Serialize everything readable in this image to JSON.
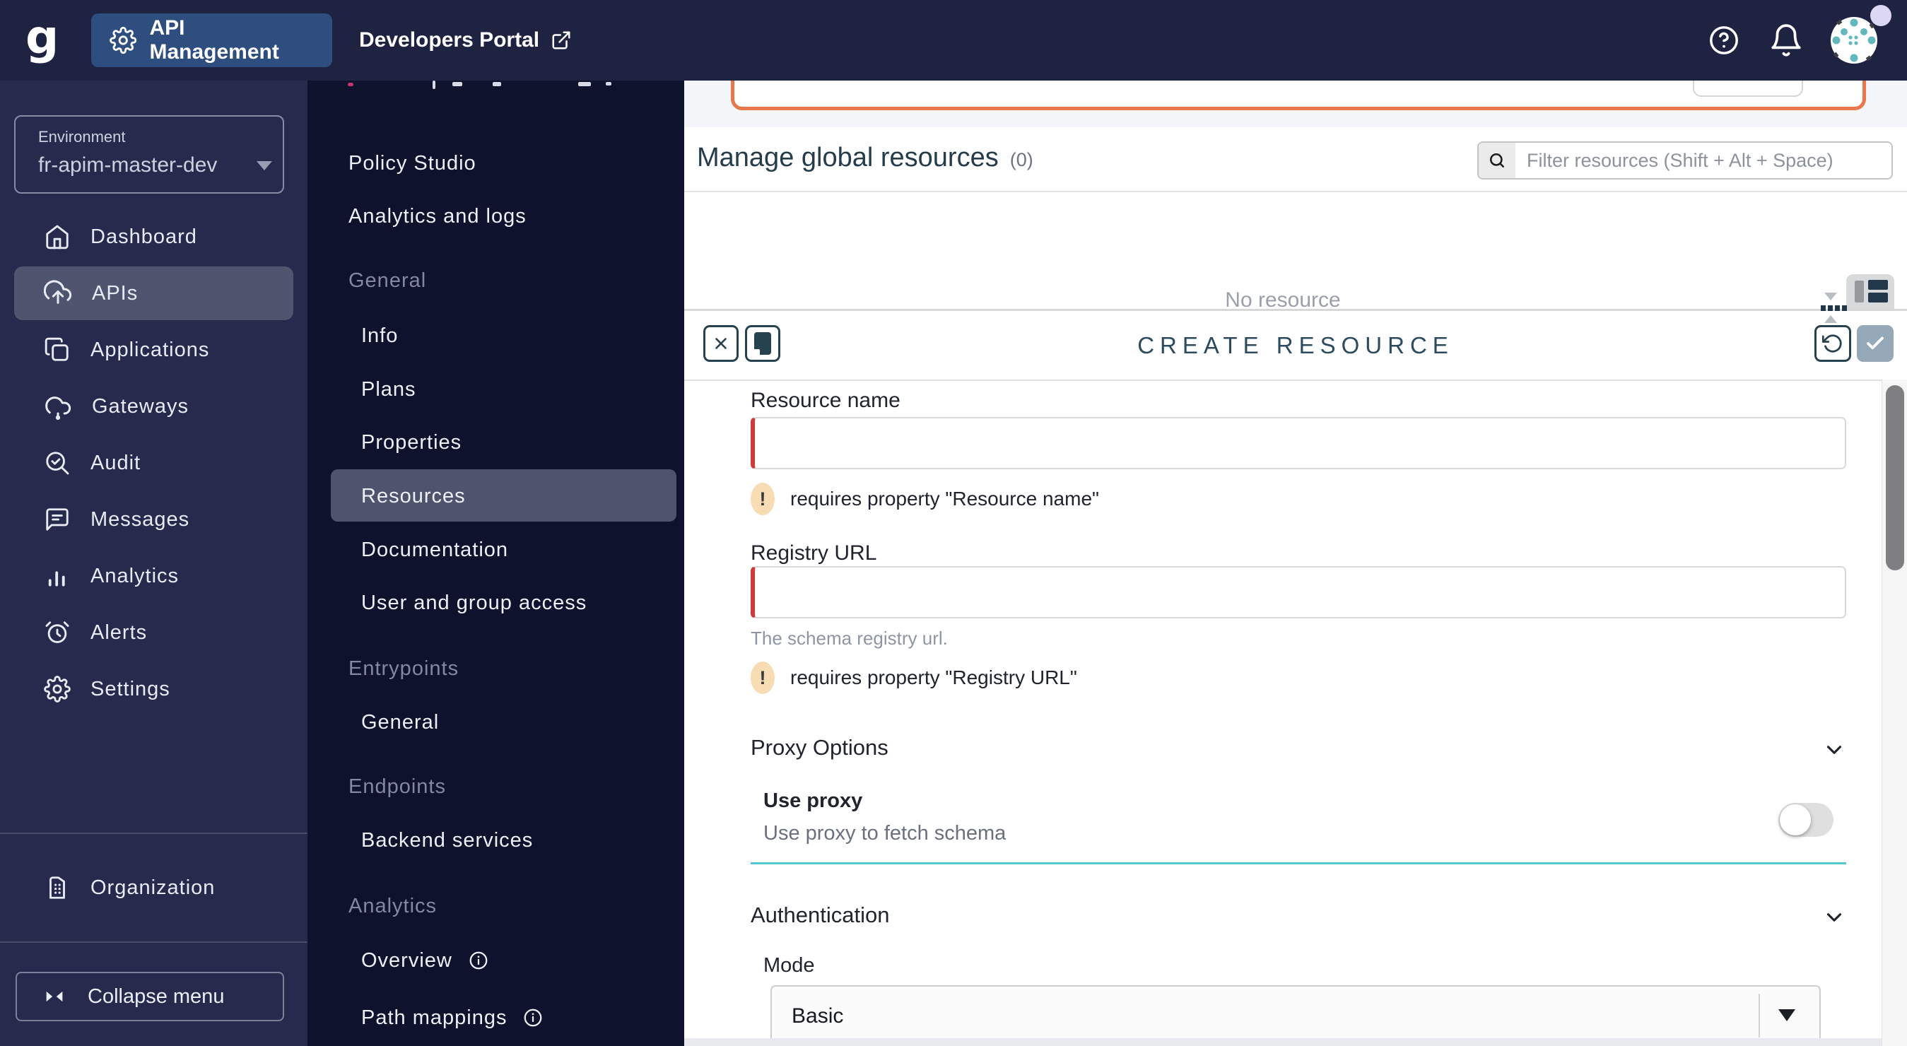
{
  "header": {
    "logo_letter": "g",
    "app_name": "API Management",
    "portal_name": "Developers Portal"
  },
  "sidebar": {
    "environment_label": "Environment",
    "environment_value": "fr-apim-master-dev",
    "items": [
      {
        "label": "Dashboard",
        "icon": "home"
      },
      {
        "label": "APIs",
        "icon": "cloud-upload",
        "selected": true
      },
      {
        "label": "Applications",
        "icon": "applications"
      },
      {
        "label": "Gateways",
        "icon": "cloud"
      },
      {
        "label": "Audit",
        "icon": "search-check"
      },
      {
        "label": "Messages",
        "icon": "chat"
      },
      {
        "label": "Analytics",
        "icon": "bar-chart"
      },
      {
        "label": "Alerts",
        "icon": "alarm"
      },
      {
        "label": "Settings",
        "icon": "gear"
      }
    ],
    "organization_label": "Organization",
    "collapse_label": "Collapse menu"
  },
  "api_menu": {
    "items": [
      {
        "label": "Policy Studio",
        "type": "item"
      },
      {
        "label": "Analytics and logs",
        "type": "item"
      },
      {
        "label": "General",
        "type": "section"
      },
      {
        "label": "Info",
        "type": "subitem"
      },
      {
        "label": "Plans",
        "type": "subitem"
      },
      {
        "label": "Properties",
        "type": "subitem"
      },
      {
        "label": "Resources",
        "type": "subitem",
        "selected": true
      },
      {
        "label": "Documentation",
        "type": "subitem"
      },
      {
        "label": "User and group access",
        "type": "subitem"
      },
      {
        "label": "Entrypoints",
        "type": "section"
      },
      {
        "label": "General",
        "type": "subitem"
      },
      {
        "label": "Endpoints",
        "type": "section"
      },
      {
        "label": "Backend services",
        "type": "subitem"
      },
      {
        "label": "Analytics",
        "type": "section"
      },
      {
        "label": "Overview",
        "type": "subitem",
        "info": true
      },
      {
        "label": "Path mappings",
        "type": "subitem",
        "info": true
      }
    ]
  },
  "resources_page": {
    "title": "Manage global resources",
    "count": "(0)",
    "filter_placeholder": "Filter resources (Shift + Alt + Space)",
    "empty_text": "No resource"
  },
  "create_panel": {
    "title": "CREATE RESOURCE",
    "resource_name": {
      "label": "Resource name",
      "value": "",
      "error_icon": "!",
      "error": "requires property \"Resource name\""
    },
    "registry_url": {
      "label": "Registry URL",
      "value": "",
      "hint": "The schema registry url.",
      "error_icon": "!",
      "error": "requires property \"Registry URL\""
    },
    "proxy_section_title": "Proxy Options",
    "use_proxy_label": "Use proxy",
    "use_proxy_description": "Use proxy to fetch schema",
    "use_proxy_enabled": false,
    "auth_section_title": "Authentication",
    "mode_label": "Mode",
    "mode_value": "Basic"
  },
  "colors": {
    "header_bg": "#1e2342",
    "sidebar_bg": "#262b4d",
    "submenu_bg": "#0f122d",
    "accent_blue": "#2d4e7e",
    "selected_item_bg": "#50556f",
    "orange_border": "#e8784c",
    "error_red": "#ce3b3b",
    "warn_badge_bg": "#f8dcb4",
    "teal_divider": "#54c8d0",
    "panel_title_color": "#2c4b5f",
    "save_button_bg": "#96a9b9",
    "avatar_dot_teal": "#63b8bd"
  }
}
